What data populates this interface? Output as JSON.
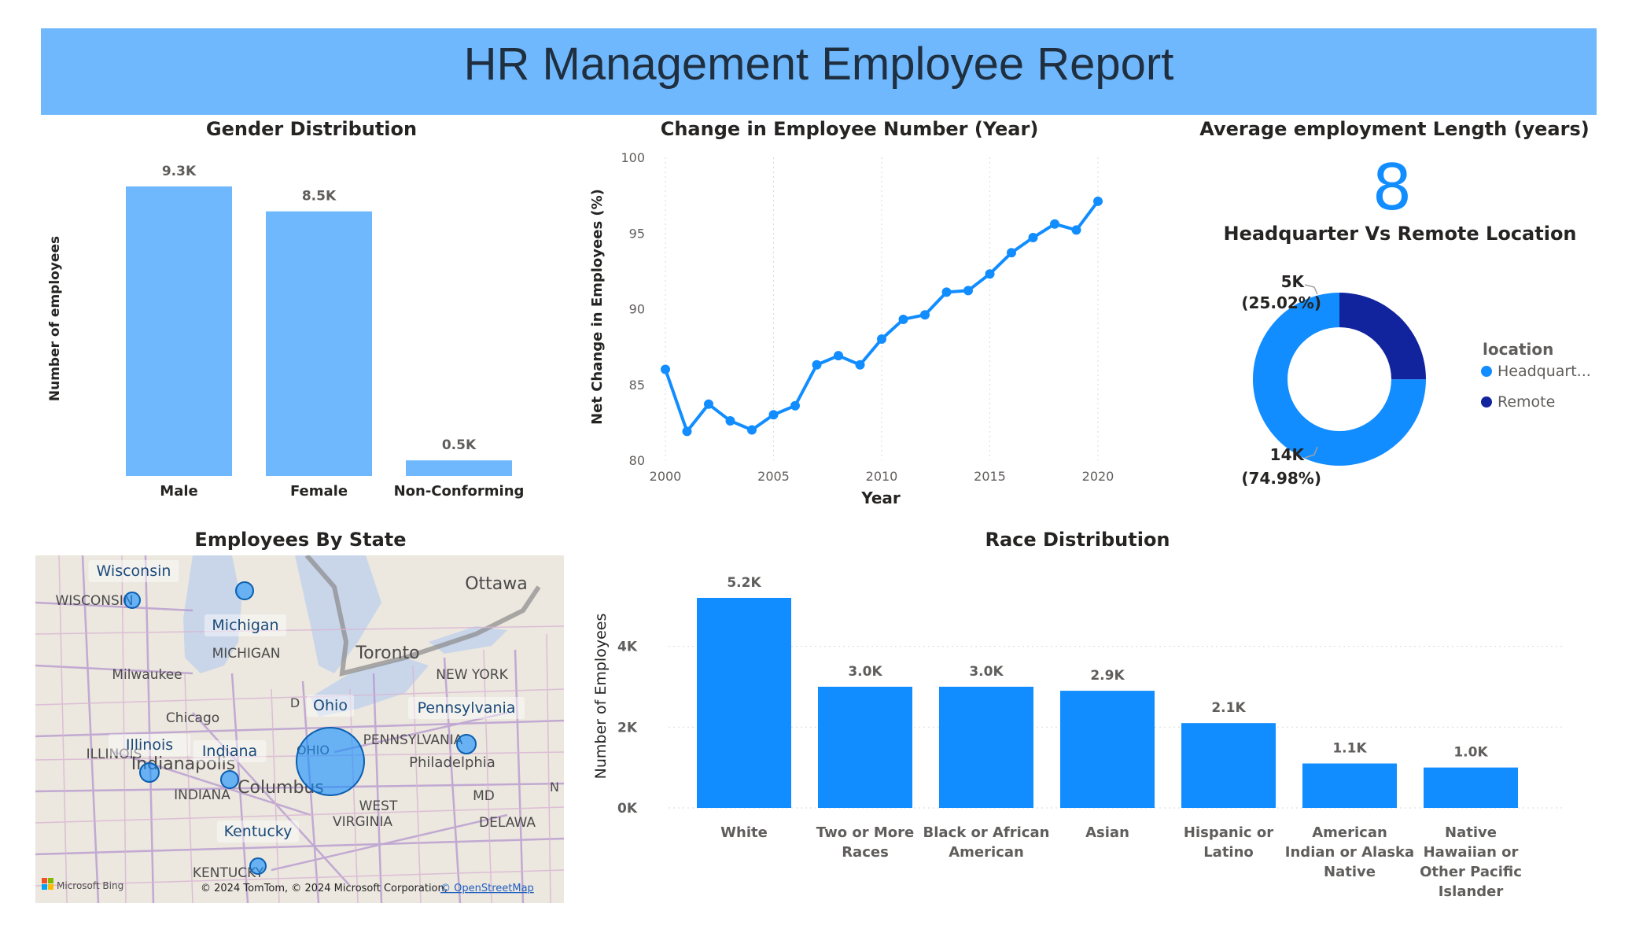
{
  "report": {
    "title": "HR Management Employee Report"
  },
  "colors": {
    "banner": "#70b8fd",
    "gender_bar": "#70b8fd",
    "blue": "#118dff",
    "navy": "#12239e"
  },
  "gender": {
    "title": "Gender Distribution",
    "chart_data": {
      "type": "bar",
      "title": "Gender Distribution",
      "xlabel": "",
      "ylabel": "Number of employees",
      "categories": [
        "Male",
        "Female",
        "Non-Conforming"
      ],
      "values": [
        9300,
        8500,
        500
      ],
      "value_labels": [
        "9.3K",
        "8.5K",
        "0.5K"
      ],
      "ylim": [
        0,
        9300
      ]
    }
  },
  "change": {
    "title": "Change in Employee Number (Year)",
    "chart_data": {
      "type": "line",
      "title": "Change in Employee Number (Year)",
      "xlabel": "Year",
      "ylabel": "Net Change in Employees (%)",
      "x": [
        2000,
        2001,
        2002,
        2003,
        2004,
        2005,
        2006,
        2007,
        2008,
        2009,
        2010,
        2011,
        2012,
        2013,
        2014,
        2015,
        2016,
        2017,
        2018,
        2019,
        2020
      ],
      "y": [
        86.0,
        81.9,
        83.7,
        82.6,
        82.0,
        83.0,
        83.6,
        86.3,
        86.9,
        86.3,
        88.0,
        89.3,
        89.6,
        91.1,
        91.2,
        92.3,
        93.7,
        94.7,
        95.6,
        95.2,
        97.1
      ],
      "xticks": [
        "2000",
        "2005",
        "2010",
        "2015",
        "2020"
      ],
      "yticks": [
        "80",
        "85",
        "90",
        "95",
        "100"
      ],
      "xlim": [
        2000,
        2020
      ],
      "ylim": [
        80,
        100
      ]
    }
  },
  "kpi": {
    "title": "Average employment Length (years)",
    "value": "8"
  },
  "location": {
    "title": "Headquarter Vs Remote Location",
    "legend_title": "location",
    "chart_data": {
      "type": "pie",
      "title": "Headquarter Vs Remote Location",
      "categories": [
        "Headquart...",
        "Remote"
      ],
      "values": [
        74.98,
        25.02
      ],
      "value_labels": [
        "14K",
        "5K"
      ],
      "percent_labels": [
        "(74.98%)",
        "(25.02%)"
      ]
    }
  },
  "map": {
    "title": "Employees By State",
    "attribution": "© 2024 TomTom, © 2024 Microsoft Corporation,",
    "attribution_link": "© OpenStreetMap",
    "brand": "Microsoft Bing",
    "state_labels": [
      "Wisconsin",
      "Michigan",
      "Ohio",
      "Pennsylvania",
      "Illinois",
      "Indiana",
      "Kentucky"
    ],
    "base_labels": [
      "WISCONSIN",
      "MICHIGAN",
      "Milwaukee",
      "Chicago",
      "ILLINOIS",
      "Indianapolis",
      "INDIANA",
      "OHIO",
      "Columbus",
      "Toronto",
      "Ottawa",
      "NEW YORK",
      "PENNSYLVANIA",
      "Philadelphia",
      "MD",
      "WEST",
      "VIRGINIA",
      "DELAWA",
      "KENTUCKY",
      "D",
      "N"
    ]
  },
  "race": {
    "title": "Race Distribution",
    "chart_data": {
      "type": "bar",
      "title": "Race Distribution",
      "xlabel": "",
      "ylabel": "Number of Employees",
      "categories": [
        "White",
        "Two or More Races",
        "Black or African American",
        "Asian",
        "Hispanic or Latino",
        "American Indian or Alaska Native",
        "Native Hawaiian or Other Pacific Islander"
      ],
      "category_lines": [
        [
          "White"
        ],
        [
          "Two or More",
          "Races"
        ],
        [
          "Black or African",
          "American"
        ],
        [
          "Asian"
        ],
        [
          "Hispanic or",
          "Latino"
        ],
        [
          "American",
          "Indian or Alaska",
          "Native"
        ],
        [
          "Native",
          "Hawaiian or",
          "Other Pacific",
          "Islander"
        ]
      ],
      "values": [
        5200,
        3000,
        3000,
        2900,
        2100,
        1100,
        1000
      ],
      "value_labels": [
        "5.2K",
        "3.0K",
        "3.0K",
        "2.9K",
        "2.1K",
        "1.1K",
        "1.0K"
      ],
      "yticks": [
        "0K",
        "2K",
        "4K"
      ],
      "ylim": [
        0,
        5200
      ]
    }
  }
}
